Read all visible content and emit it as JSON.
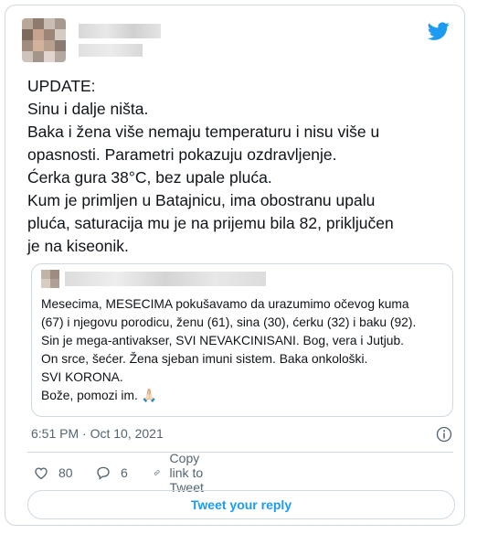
{
  "tweet": {
    "lines": [
      "UPDATE:",
      "Sinu i dalje ništa.",
      "Baka i žena više nemaju temperaturu i nisu više u",
      "opasnosti. Parametri pokazuju ozdravljenje.",
      "Ćerka gura 38°C, bez upale pluća.",
      "Kum je primljen u Batajnicu, ima obostranu upalu",
      "pluća, saturacija mu je na prijemu bila 82, priključen",
      "je na kiseonik."
    ],
    "timestamp": "6:51 PM · Oct 10, 2021"
  },
  "quote": {
    "lines": [
      "Mesecima, MESECIMA pokušavamo da urazumimo očevog kuma",
      "(67) i njegovu porodicu, ženu (61), sina (30), ćerku (32) i baku (92).",
      "Sin je mega-antivakser, SVI NEVAKCINISANI. Bog, vera i Jutjub.",
      "On srce, šećer. Žena sjeban imuni sistem. Baka onkološki.",
      "SVI KORONA.",
      "Bože, pomozi im. 🙏🏻"
    ]
  },
  "actions": {
    "like_count": "80",
    "reply_count": "6",
    "copy_link_label": "Copy link to Tweet"
  },
  "reply_button_label": "Tweet your reply",
  "colors": {
    "brand": "#1d9bf0",
    "text": "#0f1419",
    "muted": "#536471",
    "border": "#cfd9de"
  }
}
